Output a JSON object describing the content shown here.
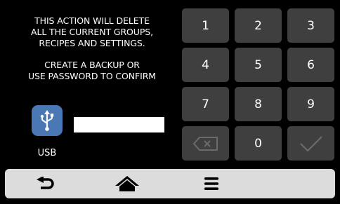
{
  "warning": {
    "line1": "THIS ACTION WILL DELETE",
    "line2": "ALL THE CURRENT GROUPS,",
    "line3": "RECIPES AND SETTINGS.",
    "line4": "CREATE A BACKUP OR",
    "line5": "USE PASSWORD TO CONFIRM"
  },
  "usb": {
    "label": "USB",
    "icon": "usb-icon"
  },
  "password": {
    "value": "",
    "placeholder": ""
  },
  "keypad": {
    "keys": [
      "1",
      "2",
      "3",
      "4",
      "5",
      "6",
      "7",
      "8",
      "9"
    ],
    "zero": "0",
    "backspace_icon": "backspace-icon",
    "confirm_icon": "checkmark-icon"
  },
  "bottom_bar": {
    "icons": [
      "back-arrow-icon",
      "home-icon",
      "menu-icon"
    ]
  },
  "colors": {
    "background": "#000000",
    "key": "#3f3f3f",
    "usb_button": "#4a78b4",
    "bottom_bar": "#dcdcdc",
    "disabled_icon": "#6b6b6b"
  }
}
